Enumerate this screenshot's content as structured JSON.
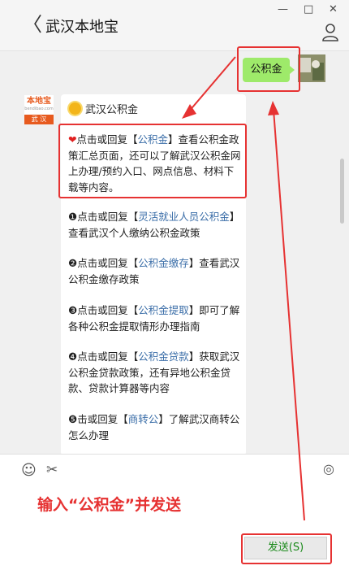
{
  "window": {
    "title": "武汉本地宝",
    "back_glyph": "〈",
    "minimize_glyph": "—",
    "maximize_glyph": "□",
    "close_glyph": "✕"
  },
  "user_message": {
    "text": "公积金"
  },
  "bot": {
    "avatar_top": "本地宝",
    "avatar_sub": "bendibao.com",
    "avatar_bottom": "武 汉",
    "name": "武汉公积金"
  },
  "messages": [
    {
      "prefix": "点击或回复【",
      "kw": "公积金",
      "suffix": "】查看公积金政策汇总页面，还可以了解武汉公积金网上办理/预约入口、网点信息、材料下载等内容。"
    },
    {
      "prefix": "❶点击或回复【",
      "kw": "灵活就业人员公积金",
      "suffix": "】查看武汉个人缴纳公积金政策"
    },
    {
      "prefix": "❷点击或回复【",
      "kw": "公积金缴存",
      "suffix": "】查看武汉公积金缴存政策"
    },
    {
      "prefix": "❸点击或回复【",
      "kw": "公积金提取",
      "suffix": "】即可了解各种公积金提取情形办理指南"
    },
    {
      "prefix": "❹点击或回复【",
      "kw": "公积金贷款",
      "suffix": "】获取武汉公积金贷款政策，还有异地公积金贷款、贷款计算器等内容"
    },
    {
      "prefix": "❺击或回复【",
      "kw": "商转公",
      "suffix": "】了解武汉商转公怎么办理"
    }
  ],
  "toolbar": {
    "emoji_icon": "emoji-icon",
    "scissors_icon": "scissors-icon",
    "history_icon": "chat-history-icon"
  },
  "annotation": {
    "instruction": "输入“公积金”并发送"
  },
  "send_button": {
    "label": "发送(S)"
  },
  "colors": {
    "highlight": "#e63232",
    "bubble": "#9eea6a",
    "keyword": "#3b6ea8"
  }
}
